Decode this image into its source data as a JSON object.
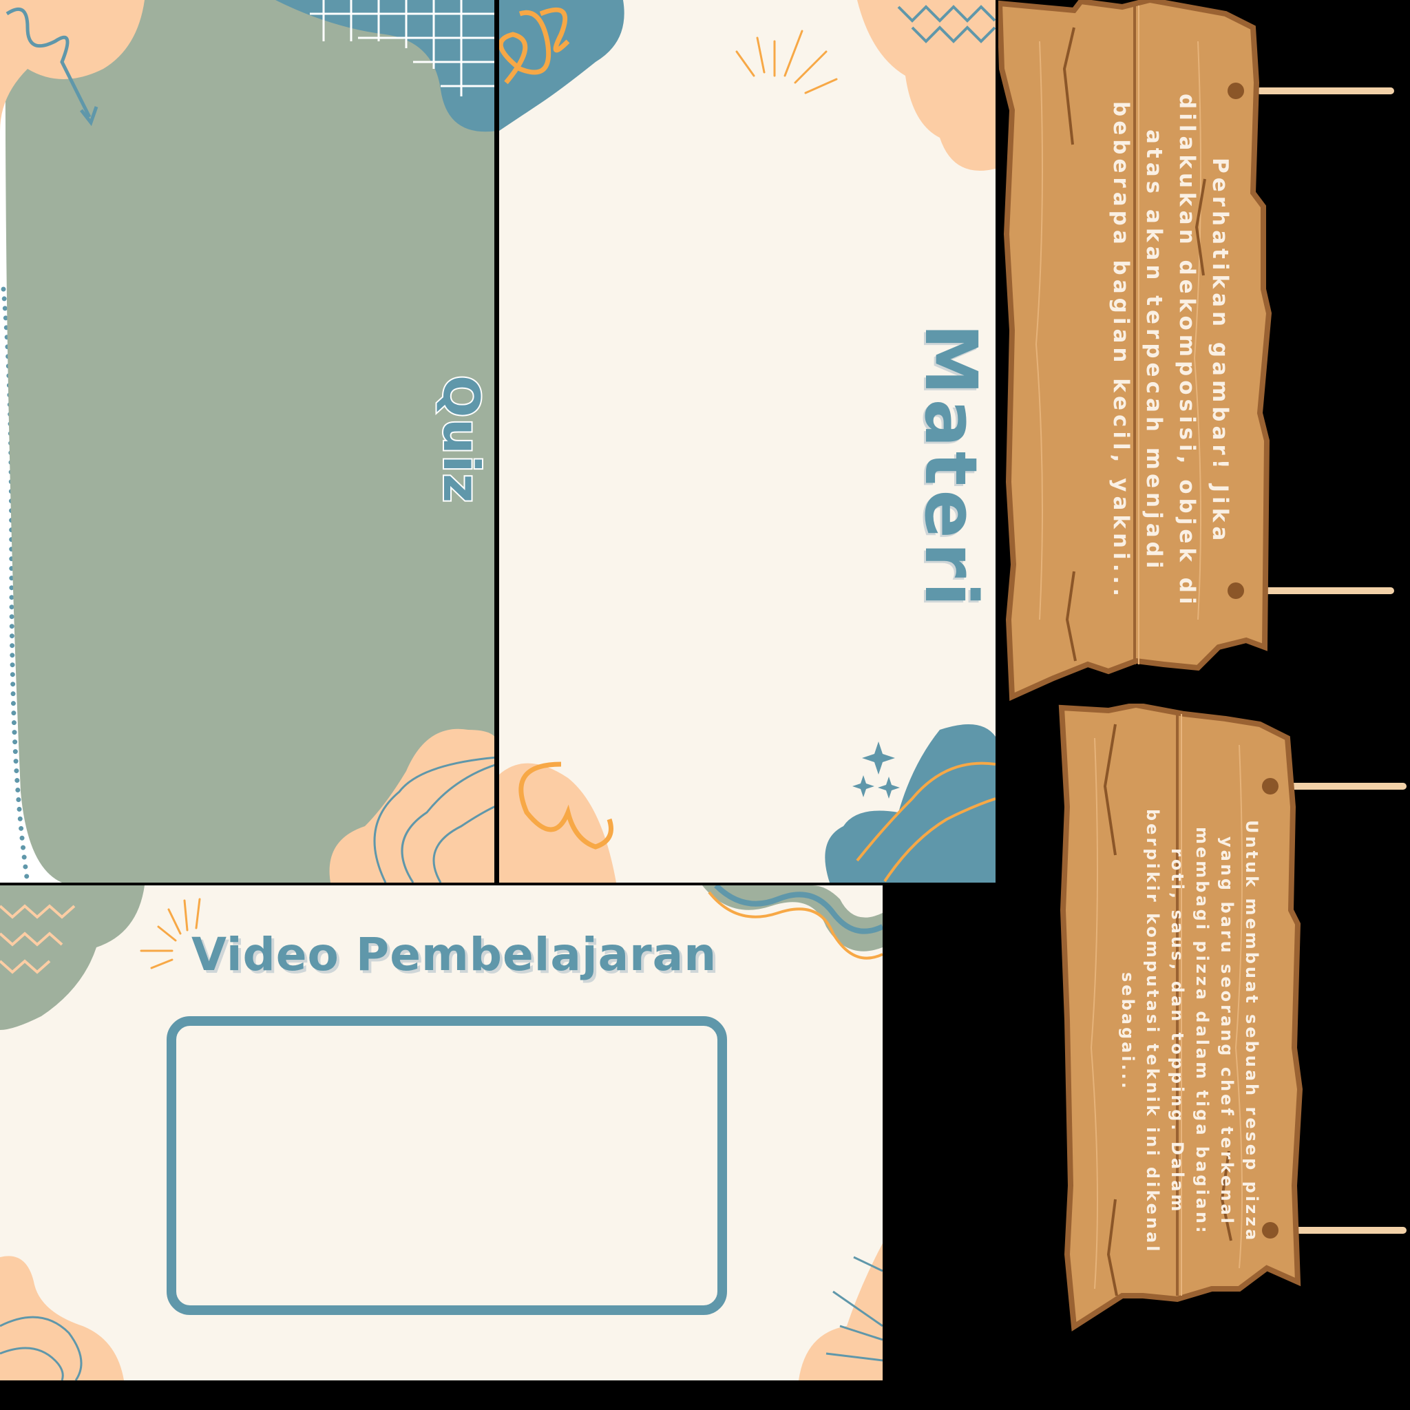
{
  "quiz": {
    "title": "Quiz"
  },
  "materi": {
    "title": "Materi"
  },
  "video": {
    "title": "Video Pembelajaran"
  },
  "sign_top": {
    "text": "Perhatikan gambar! Jika\ndilakukan dekomposisi, objek di\natas akan terpecah menjadi\nbeberapa bagian kecil, yakni..."
  },
  "sign_bottom": {
    "text": "Untuk membuat sebuah resep pizza\nyang baru seorang chef terkenal\nmembagi pizza dalam tiga bagian:\nroti, saus, dan topping. Dalam\nberpikir komputasi teknik ini dikenal\nsebagai..."
  },
  "colors": {
    "sage": "#9fb09d",
    "teal": "#5f97aa",
    "peach": "#fccda4",
    "cream": "#faf5ec",
    "orange": "#f7a846",
    "wood": "#d39a5b",
    "wood_edge": "#9a6232"
  }
}
